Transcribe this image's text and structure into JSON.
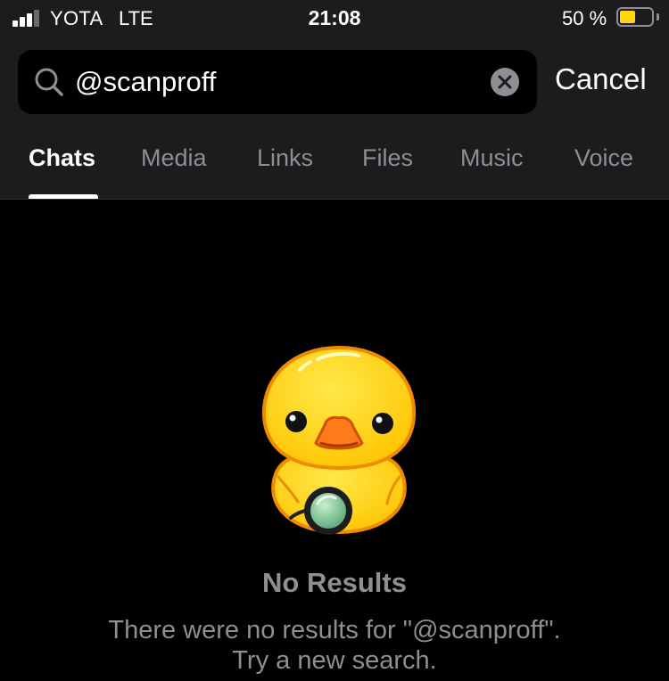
{
  "status": {
    "carrier": "YOTA",
    "network": "LTE",
    "time": "21:08",
    "battery_pct": "50 %",
    "battery_level": 0.5,
    "battery_color": "#ffd60a"
  },
  "search": {
    "value": "@scanproff",
    "cancel_label": "Cancel"
  },
  "tabs": [
    {
      "label": "Chats",
      "active": true
    },
    {
      "label": "Media",
      "active": false
    },
    {
      "label": "Links",
      "active": false
    },
    {
      "label": "Files",
      "active": false
    },
    {
      "label": "Music",
      "active": false
    },
    {
      "label": "Voice",
      "active": false
    }
  ],
  "empty": {
    "illustration": "duck-with-magnifier",
    "title": "No Results",
    "message_line1": "There were no results for \"@scanproff\".",
    "message_line2": "Try a new search."
  },
  "colors": {
    "background": "#000000",
    "header": "#1c1c1e",
    "secondary_text": "#8e8e93"
  }
}
